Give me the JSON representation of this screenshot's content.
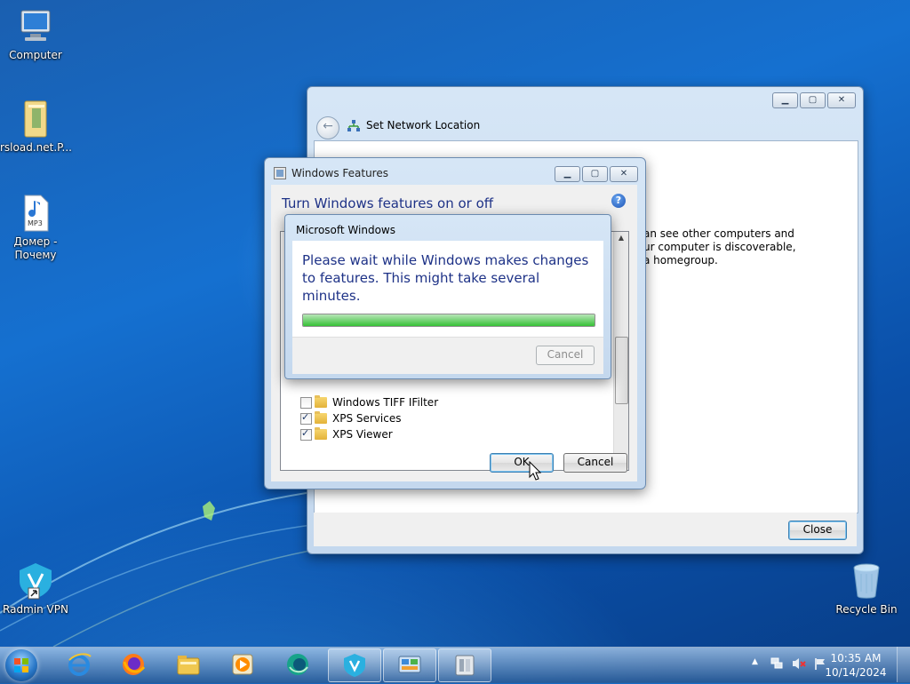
{
  "desktop": {
    "icons": [
      {
        "label": "Computer"
      },
      {
        "label": "rsload.net.P..."
      },
      {
        "label": "Домер - Почему"
      },
      {
        "label": "Radmin VPN"
      },
      {
        "label": "Recycle Bin"
      }
    ],
    "mp3_badge": "MP3"
  },
  "network_window": {
    "title": "Set Network Location",
    "body_lines": [
      "an see other computers and",
      "ur computer is discoverable,",
      "a homegroup."
    ],
    "close_label": "Close"
  },
  "features_window": {
    "title": "Windows Features",
    "heading": "Turn Windows features on or off",
    "items": [
      {
        "label": "Windows TIFF IFilter",
        "checked": false
      },
      {
        "label": "XPS Services",
        "checked": true
      },
      {
        "label": "XPS Viewer",
        "checked": true
      }
    ],
    "ok_label": "OK",
    "cancel_label": "Cancel"
  },
  "progress_dialog": {
    "title": "Microsoft Windows",
    "message": "Please wait while Windows makes changes to features. This might take several minutes.",
    "progress_fraction": 1.0,
    "cancel_label": "Cancel"
  },
  "taskbar": {
    "time": "10:35 AM",
    "date": "10/14/2024",
    "apps": [
      "internet-explorer",
      "firefox",
      "file-explorer",
      "media-player",
      "browser",
      "radmin-vpn",
      "control-panel",
      "program-features"
    ]
  },
  "colors": {
    "heading_blue": "#1e3287",
    "desktop_blue": "#1570d0"
  }
}
